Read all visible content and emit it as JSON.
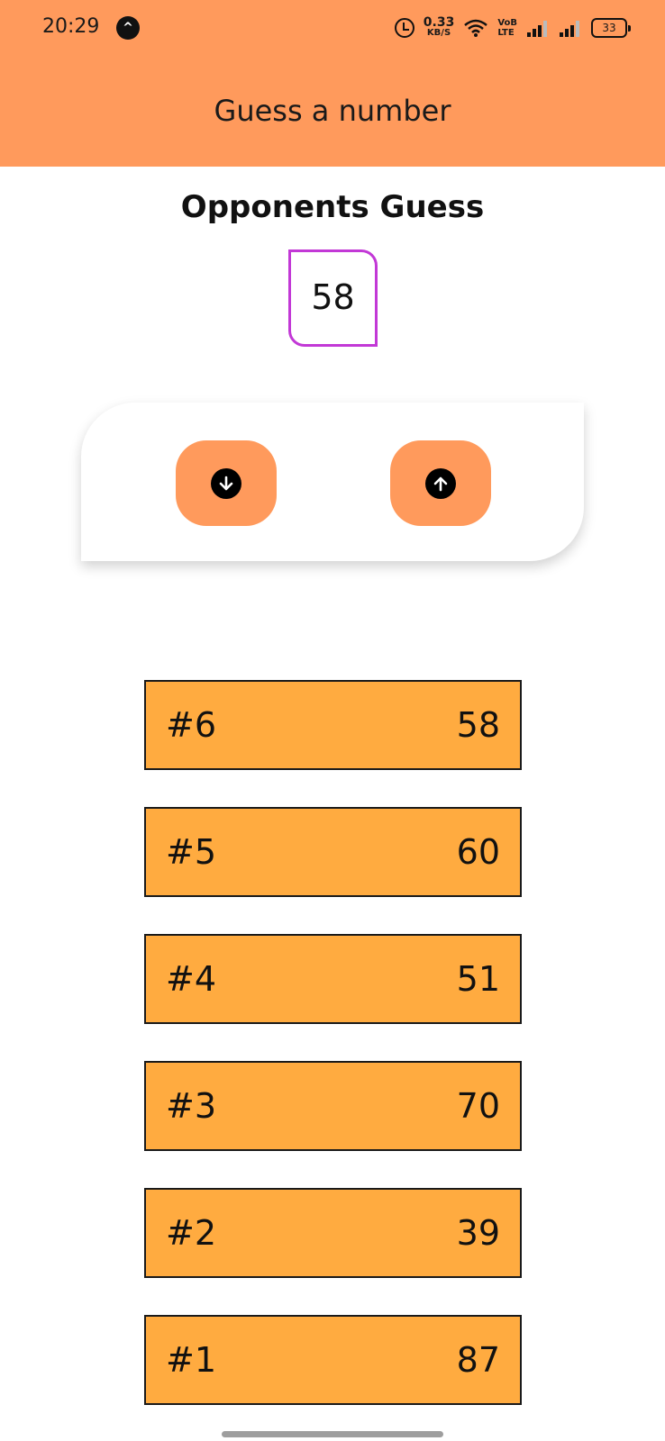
{
  "colors": {
    "header_bg": "#ff9a5c",
    "button_bg": "#ff9a5c",
    "guess_border": "#c238d6",
    "log_row_bg": "#ffab40"
  },
  "status_bar": {
    "time": "20:29",
    "app_icon": "^",
    "net_speed_value": "0.33",
    "net_speed_unit": "KB/S",
    "volte_line1": "VoB",
    "volte_line2": "LTE",
    "battery": "33"
  },
  "header": {
    "title": "Guess a number"
  },
  "main": {
    "section_title": "Opponents Guess",
    "current_guess": "58",
    "lower_button_icon": "arrow-down-icon",
    "higher_button_icon": "arrow-up-icon"
  },
  "guess_log": [
    {
      "round": "#6",
      "value": "58"
    },
    {
      "round": "#5",
      "value": "60"
    },
    {
      "round": "#4",
      "value": "51"
    },
    {
      "round": "#3",
      "value": "70"
    },
    {
      "round": "#2",
      "value": "39"
    },
    {
      "round": "#1",
      "value": "87"
    }
  ]
}
